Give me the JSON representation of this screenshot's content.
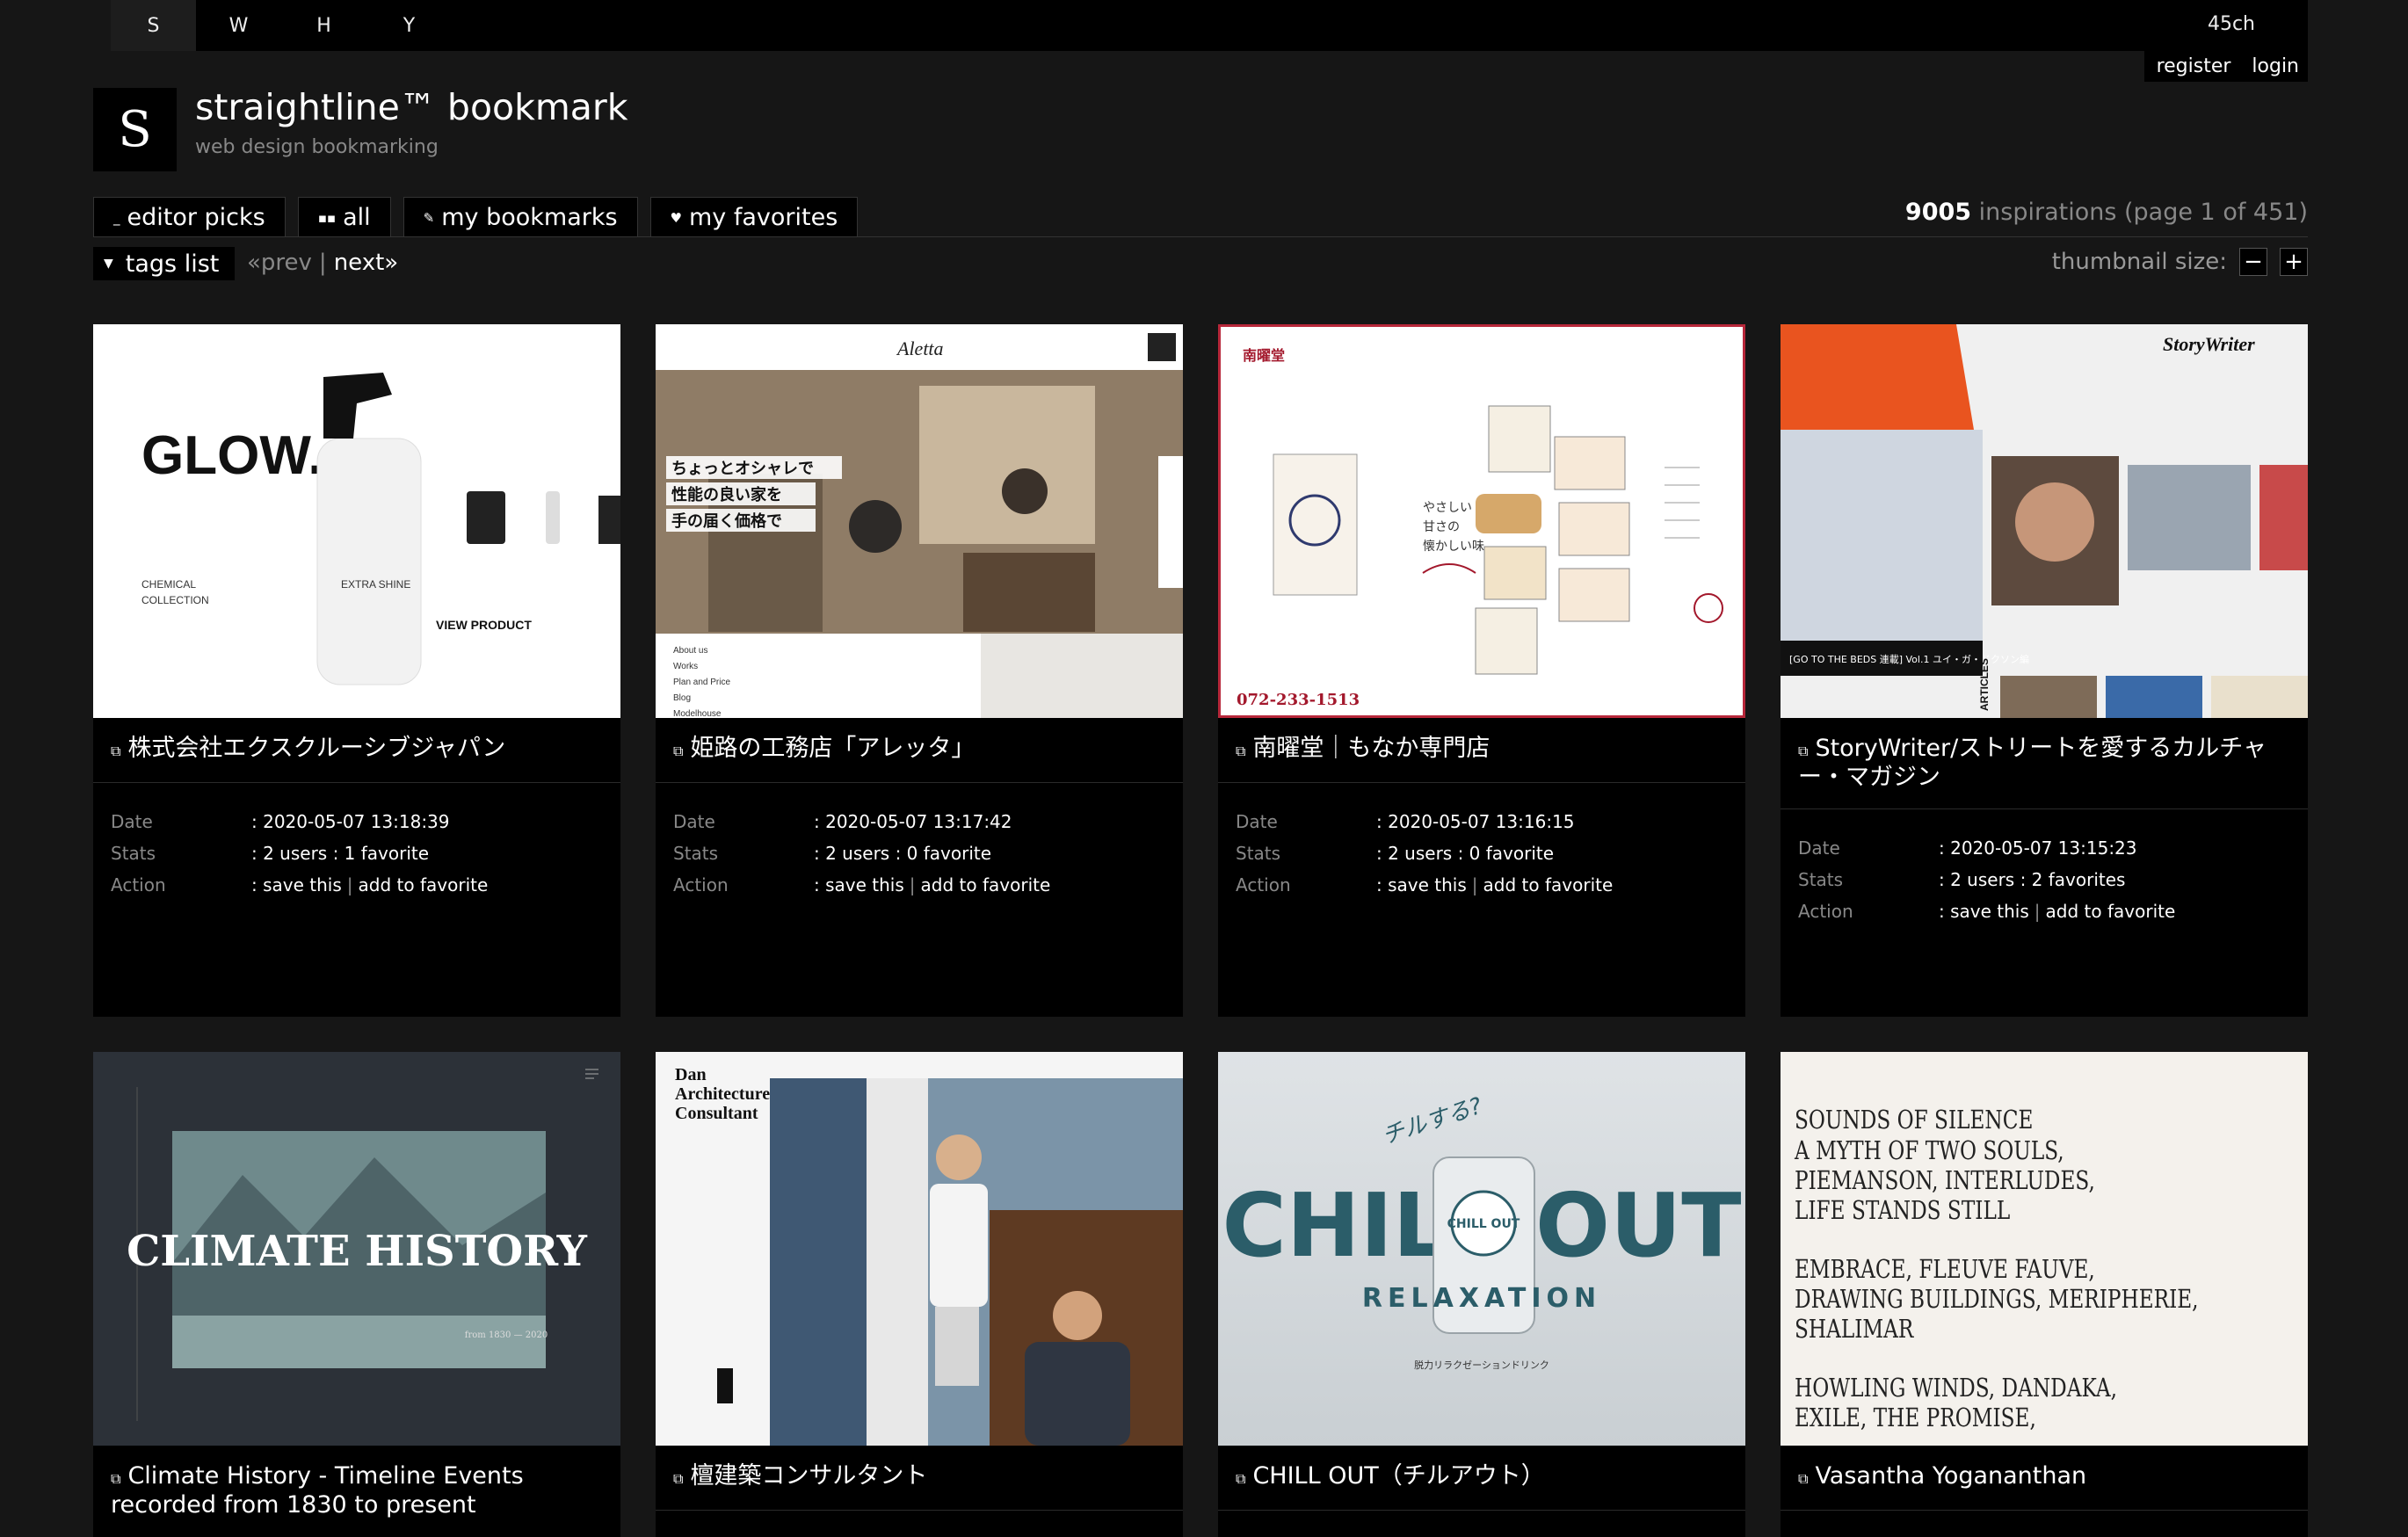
{
  "topnav": {
    "items": [
      "S",
      "W",
      "H",
      "Y"
    ],
    "active": 0,
    "count": "45ch"
  },
  "auth": {
    "register": "register",
    "login": "login"
  },
  "site": {
    "logo": "S",
    "title": "straightline™ bookmark",
    "subtitle": "web design bookmarking"
  },
  "tabs": [
    {
      "icon": "underscore-icon",
      "glyph": "_",
      "label": "editor picks"
    },
    {
      "icon": "grid-icon",
      "glyph": "▪▪",
      "label": "all"
    },
    {
      "icon": "pencil-icon",
      "glyph": "✎",
      "label": "my bookmarks"
    },
    {
      "icon": "heart-icon",
      "glyph": "♥",
      "label": "my favorites"
    }
  ],
  "summary": {
    "count": "9005",
    "text": "inspirations (page 1 of 451)"
  },
  "tags_button": {
    "icon": "triangle-down-icon",
    "label": "tags list"
  },
  "pager": {
    "prev": "«prev",
    "sep": "|",
    "next": "next»"
  },
  "thumbnail_size": {
    "label": "thumbnail size:",
    "minus": "−",
    "plus": "+"
  },
  "meta_labels": {
    "date": "Date",
    "stats": "Stats",
    "action": "Action",
    "save": "save this",
    "favorite": "add to favorite"
  },
  "cards": [
    {
      "title": "株式会社エクスクルーシブジャパン",
      "date": ": 2020-05-07 13:18:39",
      "stats": ": 2 users : 1 favorite",
      "thumb": {
        "brand": "GLOW.",
        "line1": "CHEMICAL",
        "line2": "COLLECTION",
        "label": "EXTRA SHINE",
        "cta": "VIEW PRODUCT"
      }
    },
    {
      "title": "姫路の工務店「アレッタ」",
      "date": ": 2020-05-07 13:17:42",
      "stats": ": 2 users : 0 favorite",
      "thumb": {
        "logo": "Aletta",
        "copy1": "ちょっとオシャレで",
        "copy2": "性能の良い家を",
        "copy3": "手の届く価格で",
        "menu": [
          "About us",
          "Works",
          "Plan and Price",
          "Blog",
          "Modelhouse"
        ]
      }
    },
    {
      "title": "南曜堂｜もなか専門店",
      "date": ": 2020-05-07 13:16:15",
      "stats": ": 2 users : 0 favorite",
      "thumb": {
        "brand": "南曜堂",
        "copy1": "やさしい",
        "copy2": "甘さの",
        "copy3": "懐かしい味",
        "phone": "072-233-1513"
      }
    },
    {
      "title": "StoryWriter/ストリートを愛するカルチャー・マガジン",
      "date": ": 2020-05-07 13:15:23",
      "stats": ": 2 users : 2 favorites",
      "thumb": {
        "logo": "StoryWriter",
        "caption": "[GO TO THE BEDS 連載] Vol.1 ユイ・ガ・ドクソン編",
        "side": "ARTICLES"
      }
    },
    {
      "title": "Climate History - Timeline Events recorded from 1830 to present",
      "thumb": {
        "headline": "CLIMATE HISTORY",
        "years": "from 1830 — 2020"
      }
    },
    {
      "title": "檀建築コンサルタント",
      "thumb": {
        "brand1": "Dan",
        "brand2": "Architecture",
        "brand3": "Consultant"
      }
    },
    {
      "title": "CHILL OUT（チルアウト）",
      "thumb": {
        "kana": "チルする?",
        "word": "CHILL OUT",
        "sub": "RELAXATION",
        "can": "CHILL OUT",
        "tag": "脱力リラクゼーションドリンク"
      }
    },
    {
      "title": "Vasantha Yogananthan",
      "thumb": {
        "lines": [
          "SOUNDS OF SILENCE",
          "A MYTH OF TWO SOULS,",
          "PIEMANSON, INTERLUDES,",
          "LIFE STANDS STILL",
          "EMBRACE, FLEUVE FAUVE,",
          "DRAWING BUILDINGS, MERIPHERIE,",
          "SHALIMAR",
          "HOWLING WINDS, DANDAKA,",
          "EXILE, THE PROMISE,"
        ]
      }
    }
  ],
  "colors": {
    "bg": "#161616",
    "panel": "#000000",
    "accent_red": "#b7273a"
  }
}
